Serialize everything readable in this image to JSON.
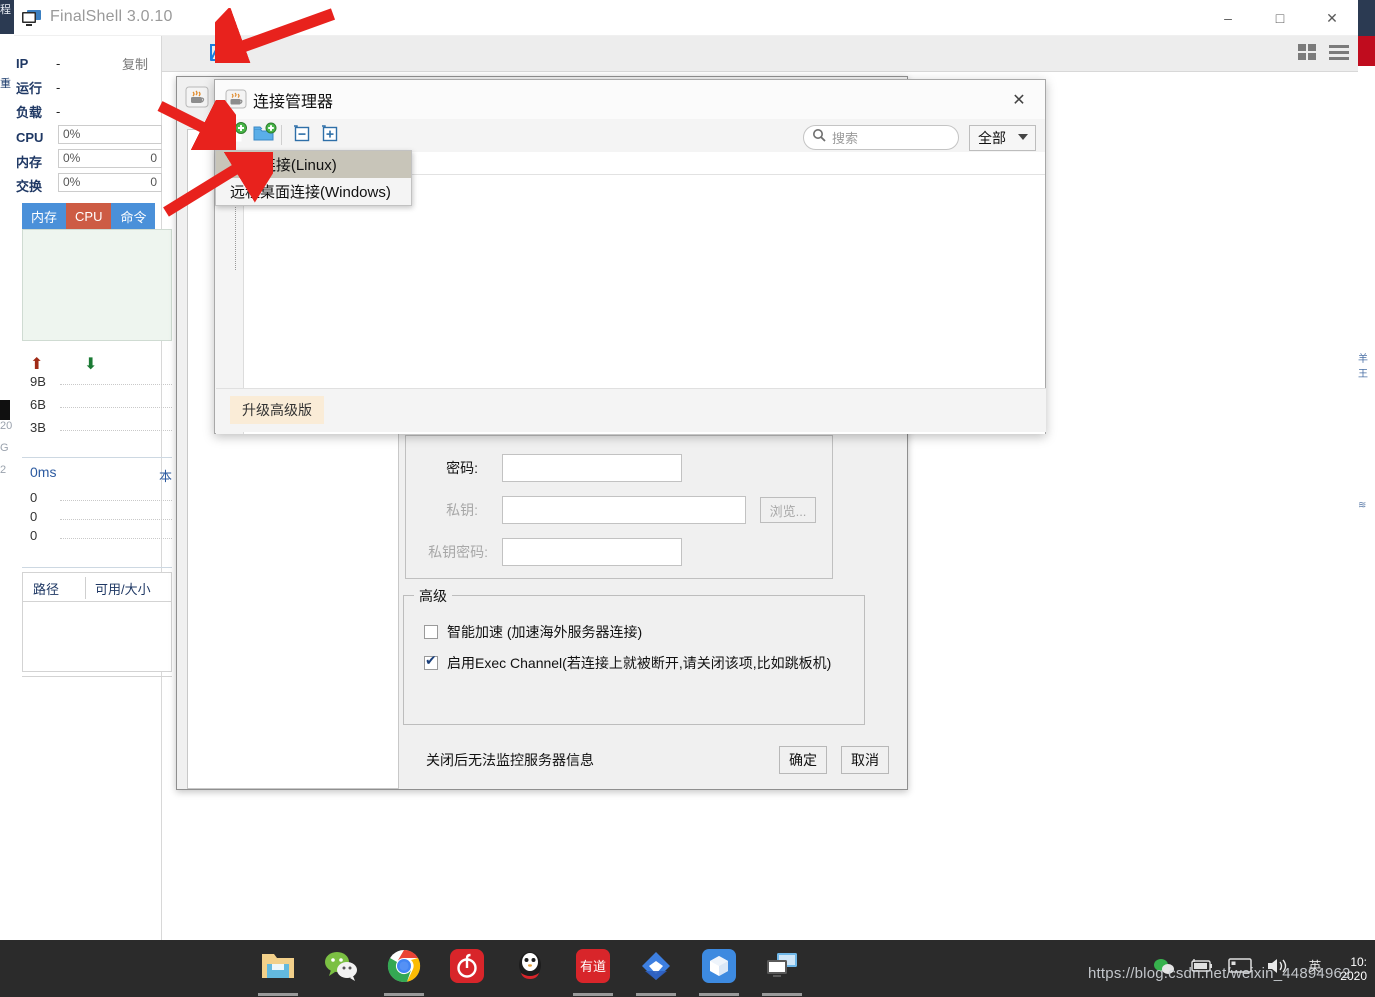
{
  "window": {
    "title": "FinalShell 3.0.10",
    "app_icon": "monitor-icon",
    "minimize": "–",
    "maximize": "□",
    "close": "✕"
  },
  "toolbar": {
    "open_folder_icon": "open-folder-icon",
    "grid_view_icon": "grid-view-icon",
    "list_view_icon": "list-view-icon"
  },
  "sidebar": {
    "rows": [
      {
        "label": "IP",
        "value": "-"
      },
      {
        "label": "运行",
        "value": "-"
      },
      {
        "label": "负载",
        "value": "-"
      }
    ],
    "copy_label": "复制",
    "meters": [
      {
        "label": "CPU",
        "value": "0%",
        "right": ""
      },
      {
        "label": "内存",
        "value": "0%",
        "right": "0"
      },
      {
        "label": "交换",
        "value": "0%",
        "right": "0"
      }
    ],
    "tabs": [
      {
        "label": "内存"
      },
      {
        "label": "CPU"
      },
      {
        "label": "命令"
      }
    ],
    "net": {
      "up_icon": "upload-arrow-icon",
      "down_icon": "download-arrow-icon",
      "ticks": [
        "9B",
        "6B",
        "3B"
      ]
    },
    "latency": {
      "title": "0ms",
      "right": "本",
      "ticks": [
        "0",
        "0",
        "0"
      ]
    },
    "disk": {
      "col_path": "路径",
      "col_free": "可用/大小"
    }
  },
  "background_dialog": {
    "icon": "java-cup-icon",
    "fields": [
      {
        "label": "密码:",
        "value": "",
        "dim": false
      },
      {
        "label": "私钥:",
        "value": "",
        "dim": true
      },
      {
        "label": "私钥密码:",
        "value": "",
        "dim": true
      }
    ],
    "browse_button": "浏览...",
    "advanced": {
      "legend": "高级",
      "options": [
        {
          "label": "智能加速 (加速海外服务器连接)",
          "checked": false
        },
        {
          "label": "启用Exec Channel(若连接上就被断开,请关闭该项,比如跳板机)",
          "checked": true
        }
      ],
      "note": "关闭后无法监控服务器信息"
    },
    "ok_button": "确定",
    "cancel_button": "取消"
  },
  "connection_manager": {
    "icon": "java-cup-icon",
    "title": "连接管理器",
    "close": "✕",
    "toolbar": {
      "new_connection_icon": "new-connection-icon",
      "new_folder_icon": "new-folder-icon",
      "collapse_all_icon": "collapse-all-icon",
      "expand_all_icon": "expand-all-icon"
    },
    "search": {
      "placeholder": "搜索",
      "value": "",
      "icon": "search-icon"
    },
    "filter": {
      "selected": "全部",
      "options": [
        "全部"
      ]
    },
    "tree_collapse_icon": "tree-collapse-icon",
    "footer": {
      "upgrade_label": "升级高级版"
    }
  },
  "context_menu": {
    "items": [
      {
        "label": "SSH连接(Linux)",
        "selected": true
      },
      {
        "label": "远程桌面连接(Windows)",
        "selected": false
      }
    ]
  },
  "taskbar": {
    "items": [
      {
        "name": "file-explorer-icon",
        "open": true
      },
      {
        "name": "wechat-icon",
        "open": false
      },
      {
        "name": "chrome-icon",
        "open": true
      },
      {
        "name": "netease-music-icon",
        "open": false
      },
      {
        "name": "qq-icon",
        "open": false
      },
      {
        "name": "youdao-icon",
        "open": true
      },
      {
        "name": "wps-icon",
        "open": true
      },
      {
        "name": "sandbox-icon",
        "open": true
      },
      {
        "name": "remote-desktop-icon",
        "open": true
      }
    ],
    "tray": {
      "wechat_icon": "wechat-tray-icon",
      "battery_icon": "battery-icon",
      "display_icon": "display-icon",
      "volume_icon": "volume-icon",
      "ime_icon": "ime-icon",
      "clock_time": "10:",
      "clock_date": "2020"
    }
  },
  "watermark": {
    "text": "https://blog.csdn.net/weixin_44894962"
  },
  "edge_text": {
    "top_left": "程",
    "mid_left": "重",
    "ghost": [
      "20",
      "G",
      "2"
    ]
  },
  "colors": {
    "accent_blue": "#4a90d9",
    "accent_red": "#cd5c44",
    "title_blue": "#1f3864",
    "arrow_red": "#e8221d",
    "upgrade_bg": "#faecd7",
    "taskbar_bg": "#2b2b2b"
  }
}
